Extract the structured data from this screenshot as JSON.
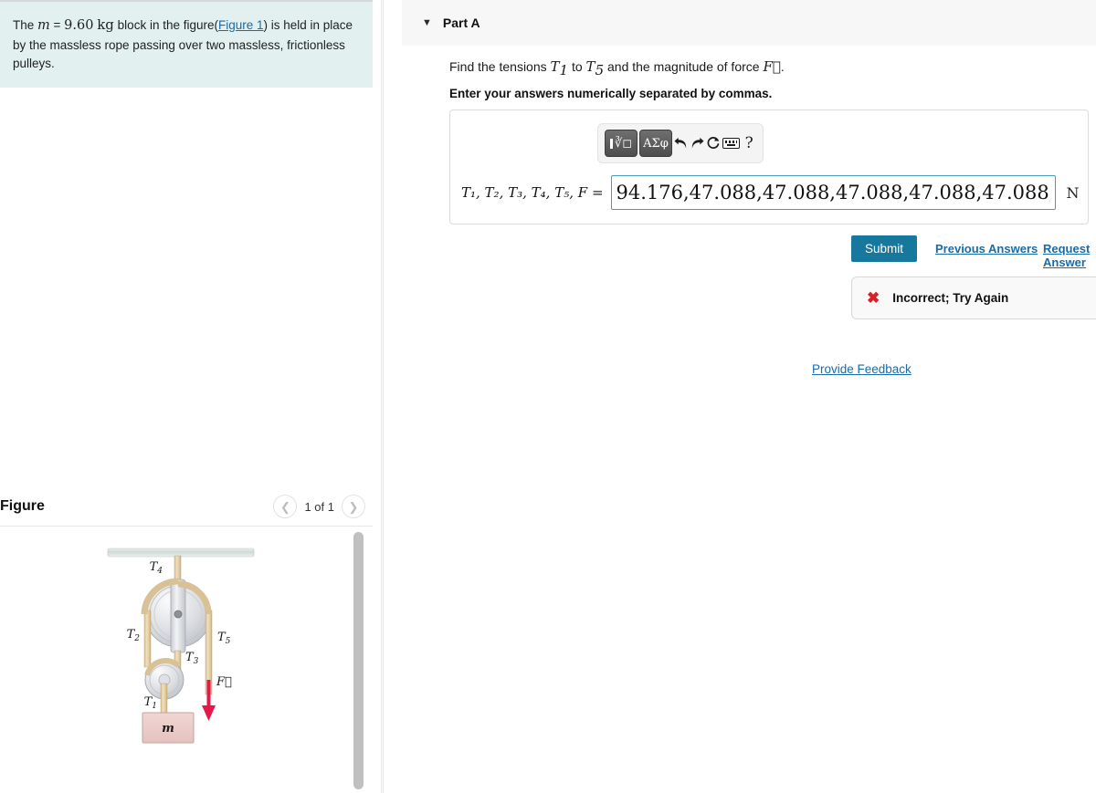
{
  "problem": {
    "text_before_var": "The ",
    "variable": "m",
    "equals": " = ",
    "value": "9.60",
    "unit": "kg",
    "text_after_value": " block in the figure(",
    "figure_link": "Figure 1",
    "text_after_link": ") is held in place by the massless rope passing over two massless, frictionless pulleys."
  },
  "figure_panel": {
    "title": "Figure",
    "pager_label": "1 of 1",
    "prev_icon": "chevron-left-icon",
    "next_icon": "chevron-right-icon",
    "diagram": {
      "labels": {
        "T1": "T",
        "T1_sub": "1",
        "T2": "T",
        "T2_sub": "2",
        "T3": "T",
        "T3_sub": "3",
        "T4": "T",
        "T4_sub": "4",
        "T5": "T",
        "T5_sub": "5",
        "force": "F",
        "mass": "m"
      },
      "colors": {
        "ceiling": "#cfdcdc",
        "rope": "#e8d3a8",
        "pulley": "#d8dade",
        "block": "#eccdcb",
        "block_border": "#c9a5a2",
        "force_arrow": "#e8174a"
      }
    }
  },
  "part": {
    "caret_icon": "chevron-down-icon",
    "title": "Part A",
    "question_prefix": "Find the tensions ",
    "question_T1": "T",
    "question_T1_sub": "1",
    "question_mid": " to ",
    "question_T5": "T",
    "question_T5_sub": "5",
    "question_suffix": " and the magnitude of force ",
    "question_force": "F",
    "question_period": ".",
    "instruction": "Enter your answers numerically separated by commas."
  },
  "toolbar": {
    "template_button_label": "√",
    "template_button_icon": "math-template-icon",
    "greek_button_label": "ΑΣφ",
    "undo_icon": "undo-arrow-icon",
    "undo_glyph": "↶",
    "redo_icon": "redo-arrow-icon",
    "redo_glyph": "↷",
    "reset_icon": "reset-circle-icon",
    "reset_glyph": "⟳",
    "keyboard_icon": "keyboard-icon",
    "help_icon": "help-question-icon",
    "help_glyph": "?"
  },
  "answer": {
    "label": "T₁, T₂, T₃, T₄, T₅, F =",
    "value": "94.176,47.088,47.088,47.088,47.088,47.088,",
    "placeholder": "",
    "unit": "N"
  },
  "actions": {
    "submit_label": "Submit",
    "previous_answers_label": "Previous Answers",
    "request_answer_label": "Request Answer",
    "provide_feedback_label": "Provide Feedback"
  },
  "feedback": {
    "icon": "incorrect-x-icon",
    "icon_glyph": "✖",
    "message": "Incorrect; Try Again"
  },
  "colors": {
    "problem_background": "#e2f1ef",
    "submit_button": "#17789e",
    "link": "#1a6ba8",
    "error": "#d81f2a",
    "input_border": "#4a9cbf",
    "part_header_background": "#f7f7f7"
  }
}
